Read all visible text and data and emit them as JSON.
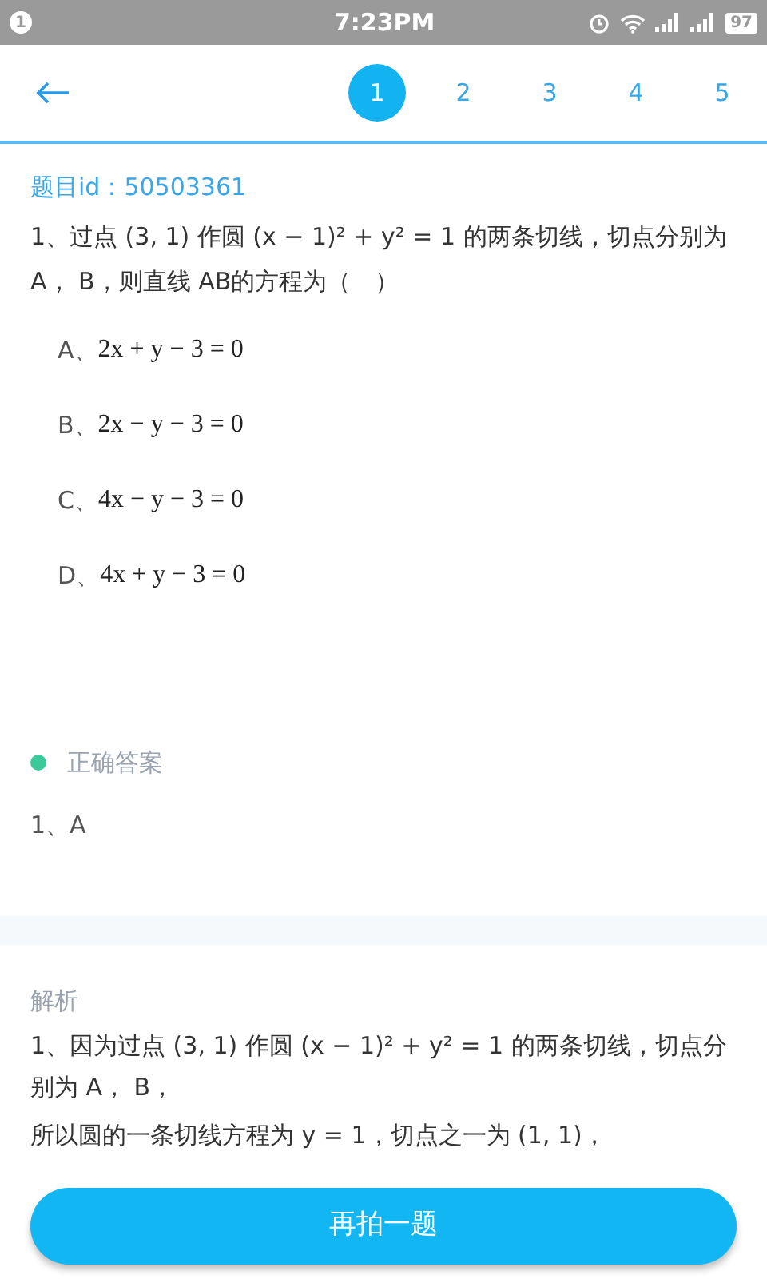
{
  "status_bar": {
    "notification": "1",
    "time": "7:23PM",
    "battery": "97"
  },
  "header": {
    "tabs": [
      {
        "label": "1",
        "selected": true
      },
      {
        "label": "2",
        "selected": false
      },
      {
        "label": "3",
        "selected": false
      },
      {
        "label": "4",
        "selected": false
      },
      {
        "label": "5",
        "selected": false
      }
    ]
  },
  "question": {
    "id_label": "题目id：50503361",
    "text": "1、过点 (3, 1) 作圆 (x − 1)² + y² = 1 的两条切线，切点分别为 A， B，则直线 AB的方程为（　）",
    "options": [
      {
        "label": "A、",
        "formula": "2x + y − 3 = 0"
      },
      {
        "label": "B、",
        "formula": "2x − y − 3 = 0"
      },
      {
        "label": "C、",
        "formula": "4x − y − 3 = 0"
      },
      {
        "label": "D、",
        "formula": "4x + y − 3 = 0"
      }
    ]
  },
  "answer": {
    "title": "正确答案",
    "color": "#3cc99a",
    "text": "1、A"
  },
  "analysis": {
    "title": "解析",
    "lines": [
      "1、因为过点 (3, 1) 作圆 (x − 1)² + y² = 1 的两条切线，切点分别为 A， B，",
      "所以圆的一条切线方程为 y = 1，切点之一为 (1, 1)，"
    ]
  },
  "button": {
    "label": "再拍一题"
  }
}
